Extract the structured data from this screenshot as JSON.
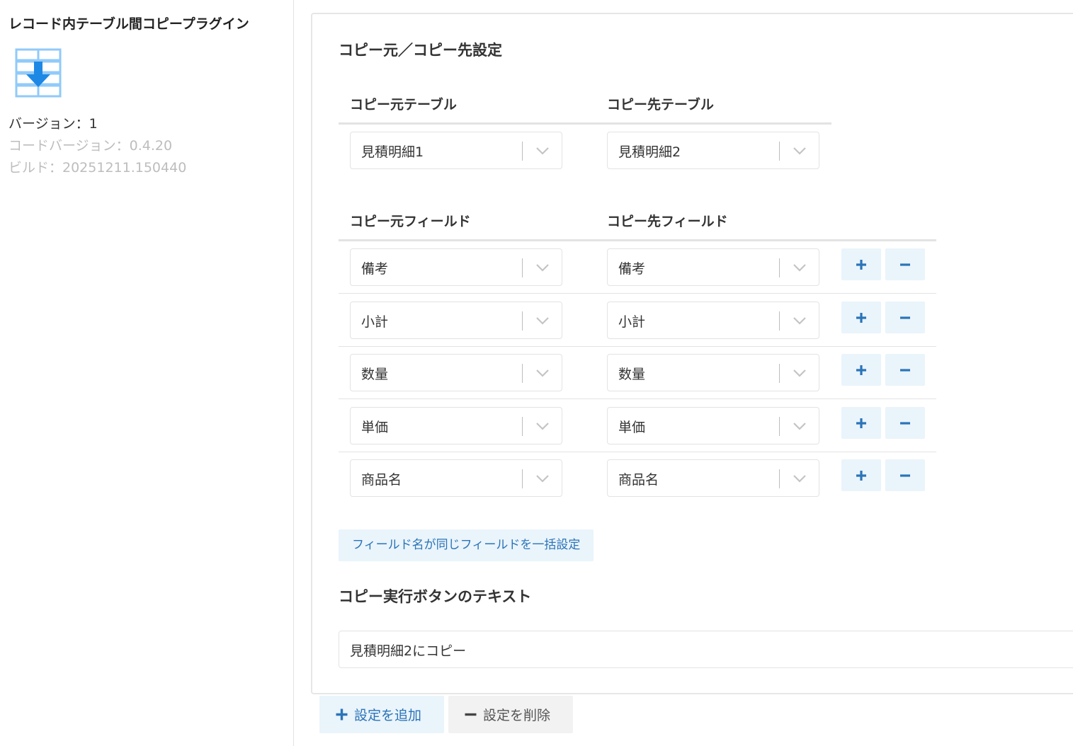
{
  "sidebar": {
    "title": "レコード内テーブル間コピープラグイン",
    "icon": "table-copy-icon",
    "version": "バージョン：1",
    "code_version": "コードバージョン：0.4.20",
    "build": "ビルド：20251211.150440"
  },
  "copy_settings": {
    "title": "コピー元／コピー先設定",
    "source_table_header": "コピー元テーブル",
    "dest_table_header": "コピー先テーブル",
    "source_table": "見積明細1",
    "dest_table": "見積明細2",
    "source_field_header": "コピー元フィールド",
    "dest_field_header": "コピー先フィールド",
    "rows": [
      {
        "source": "備考",
        "dest": "備考"
      },
      {
        "source": "小計",
        "dest": "小計"
      },
      {
        "source": "数量",
        "dest": "数量"
      },
      {
        "source": "単価",
        "dest": "単価"
      },
      {
        "source": "商品名",
        "dest": "商品名"
      }
    ],
    "bulk_button": "フィールド名が同じフィールドを一括設定"
  },
  "button_text": {
    "title": "コピー実行ボタンのテキスト",
    "value": "見積明細2にコピー"
  },
  "footer": {
    "add_label": "設定を追加",
    "remove_label": "設定を削除"
  },
  "colors": {
    "accent": "#2a74b8",
    "accent_bg": "#eaf4fb",
    "icon_blue": "#1e88e5",
    "icon_light": "#90caf9",
    "muted_text": "#bdbdbd"
  }
}
